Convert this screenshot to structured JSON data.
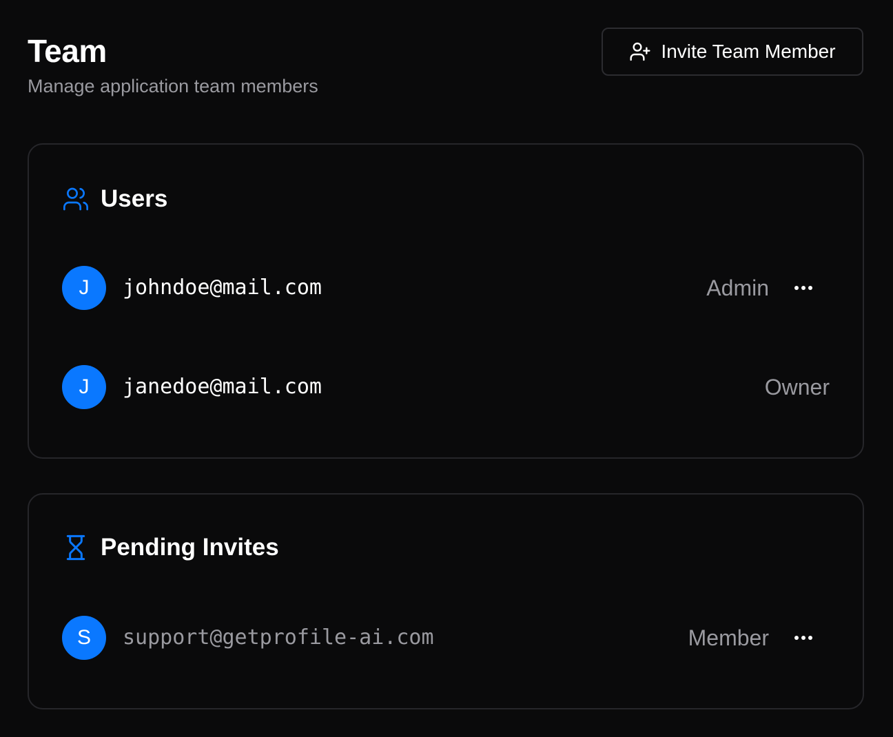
{
  "header": {
    "title": "Team",
    "subtitle": "Manage application team members",
    "invite_button": {
      "label": "Invite Team Member",
      "icon": "user-plus-icon"
    }
  },
  "users_card": {
    "title": "Users",
    "icon": "users-icon",
    "members": [
      {
        "avatar": "J",
        "email": "johndoe@mail.com",
        "role": "Admin",
        "has_menu": true
      },
      {
        "avatar": "J",
        "email": "janedoe@mail.com",
        "role": "Owner",
        "has_menu": false
      }
    ]
  },
  "pending_card": {
    "title": "Pending Invites",
    "icon": "hourglass-icon",
    "invites": [
      {
        "avatar": "S",
        "email": "support@getprofile-ai.com",
        "role": "Member",
        "has_menu": true
      }
    ]
  },
  "colors": {
    "background": "#0a0a0b",
    "accent": "#0a78ff",
    "muted_text": "#9a9aa0",
    "border": "#26262a"
  }
}
